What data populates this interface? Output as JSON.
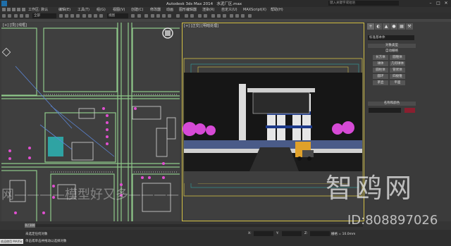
{
  "window": {
    "title": "Autodesk 3ds Max 2014",
    "file": "水泥厂区.max",
    "search_placeholder": "键入关键字或短语",
    "minimize": "–",
    "maximize": "□",
    "close": "✕"
  },
  "menubar": {
    "workspace": "工作区: 默认",
    "items": [
      "编辑(E)",
      "工具(T)",
      "组(G)",
      "视图(V)",
      "创建(C)",
      "修改器",
      "动画",
      "图形编辑器",
      "渲染(R)",
      "自定义(U)",
      "MAXScript(X)",
      "帮助(H)"
    ]
  },
  "toolbar": {
    "filter": "全部",
    "view": "视图"
  },
  "viewports": {
    "left_label": "[+] [顶] [线框]",
    "right_label": "[+] [正交] [明暗处理]"
  },
  "command_panel": {
    "tabs": [
      "+",
      "◐",
      "▲",
      "●",
      "▦",
      "⚒"
    ],
    "category": "标准基本体",
    "rollup_object_type": "对象类型",
    "autogrid": "自动栅格",
    "object_buttons": [
      "长方体",
      "圆锥体",
      "球体",
      "几何球体",
      "圆柱体",
      "管状体",
      "圆环",
      "四棱锥",
      "茶壶",
      "平面"
    ],
    "rollup_name_color": "名称和颜色",
    "object_color": "#8a1f2f"
  },
  "timeslider": {
    "frame": "0 / 100"
  },
  "status": {
    "maxscript_label": "欢迎使用 MAXSc",
    "line1": "未选定任何对象",
    "line2": "单击或单击并拖动以选择对象",
    "x_label": "X:",
    "y_label": "Y:",
    "z_label": "Z:",
    "grid": "栅格 = 10.0mm"
  },
  "watermark": {
    "brand": "智鸥网",
    "id": "ID:808897026",
    "slogan": "网————模型好又多————"
  },
  "colors": {
    "road_green": "#8fc98a",
    "building": "#c8c8c8",
    "tree_pink": "#e04fd0",
    "sky_dark": "#161616",
    "viewport_active": "#d4c145"
  }
}
